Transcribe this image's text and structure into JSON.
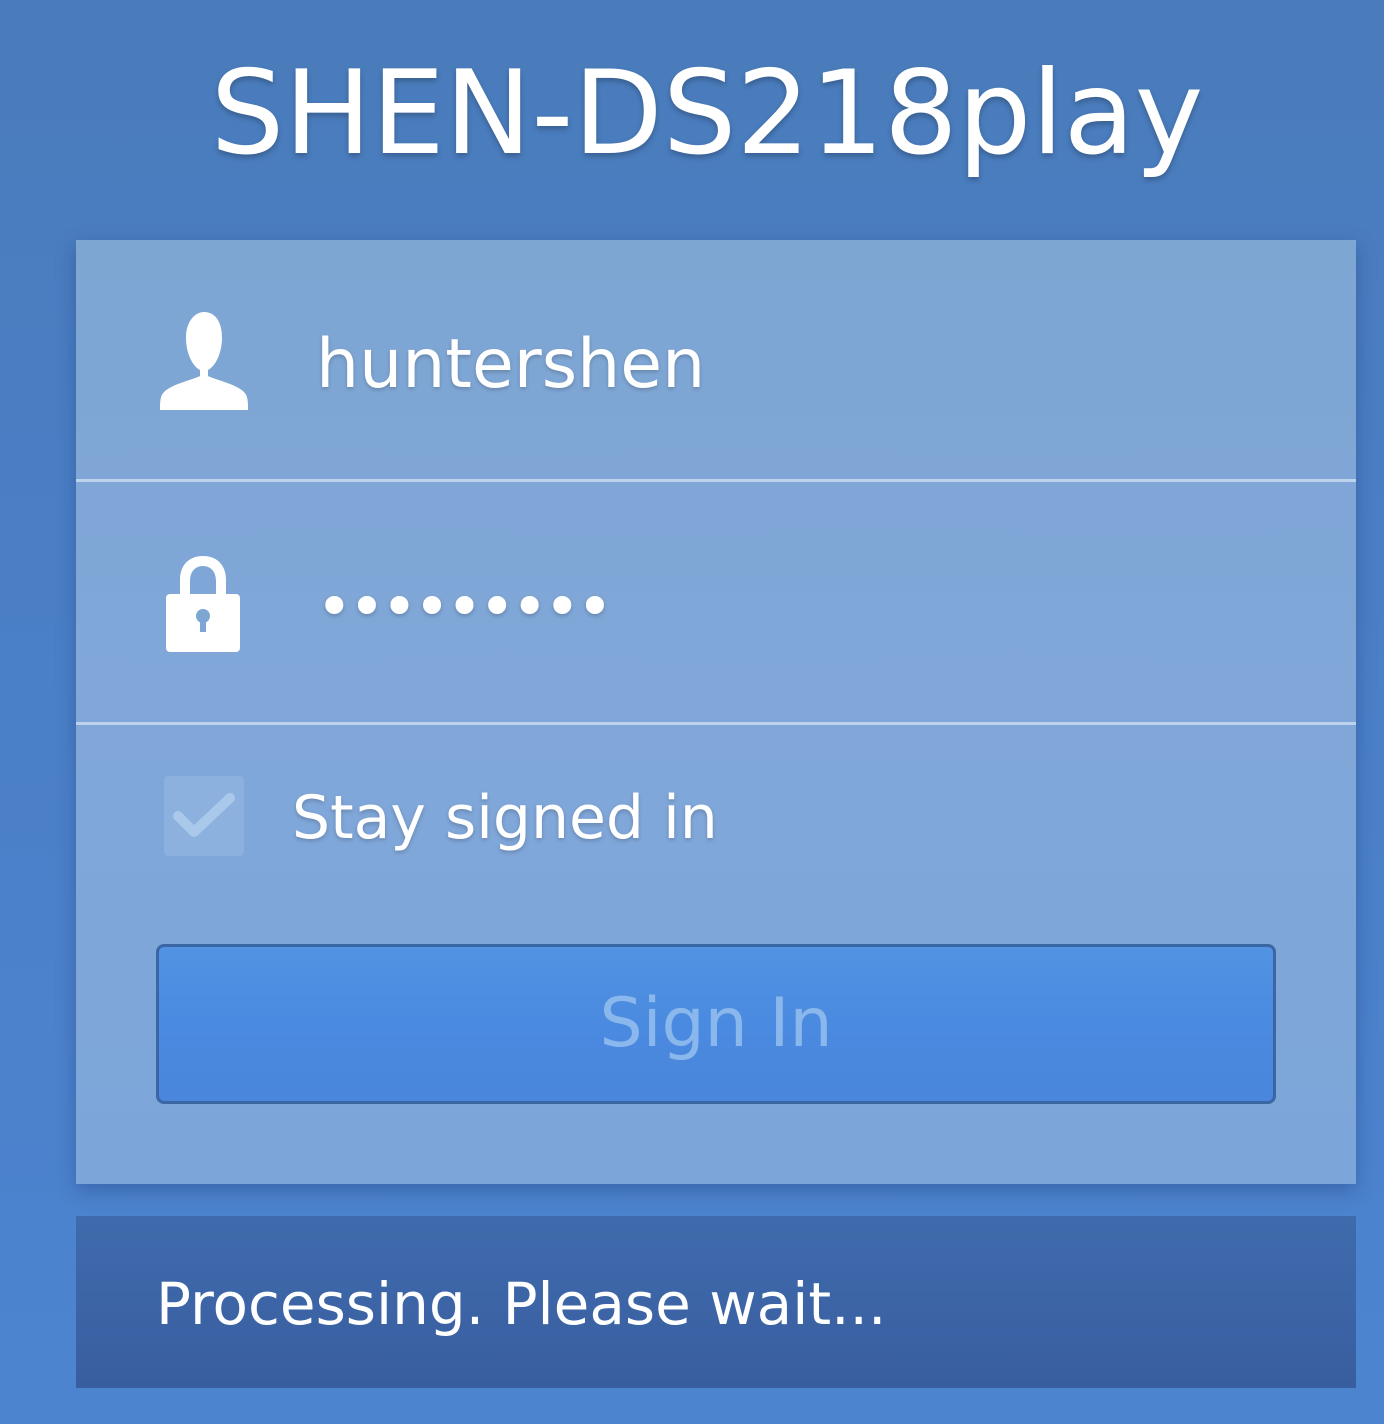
{
  "title": "SHEN-DS218play",
  "login": {
    "username_value": "huntershen",
    "password_mask": "•••••••••",
    "stay_signed_in_label": "Stay signed in",
    "stay_signed_in_checked": true,
    "sign_in_label": "Sign In"
  },
  "status": {
    "message": "Processing. Please wait..."
  },
  "icons": {
    "username": "user-icon",
    "password": "lock-icon",
    "checkbox": "checkmark-icon"
  },
  "colors": {
    "background": "#4a7fc6",
    "panel": "#80a7d9",
    "button": "#4a8ae0",
    "button_text": "#8ab8ec",
    "status_bar": "#3c64a6"
  }
}
